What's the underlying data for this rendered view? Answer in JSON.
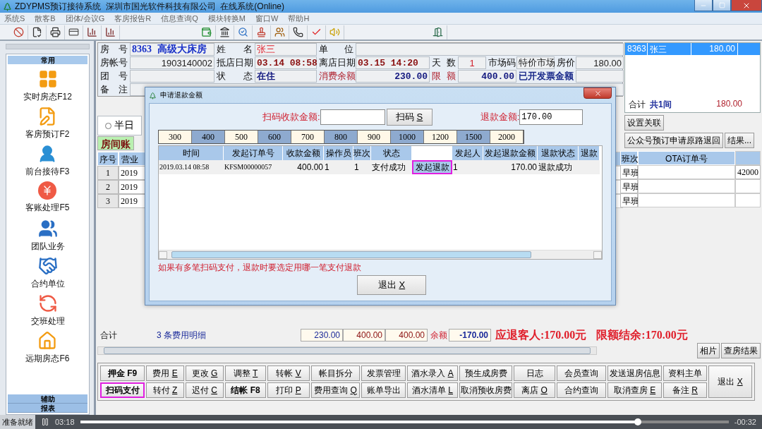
{
  "window": {
    "title": "ZDYPMS预订接待系统  深圳市国光软件科技有限公司  在线系统(Online)"
  },
  "menu": [
    "系统S",
    "散客B",
    "团体/会议G",
    "客房报告R",
    "信息查询Q",
    "模块转换M",
    "窗口W",
    "帮助H"
  ],
  "sidebar": {
    "sections": [
      {
        "label": "常用",
        "expanded": true,
        "items": [
          {
            "label": "实时房态F12",
            "kind": "grid"
          },
          {
            "label": "客房预订F2",
            "kind": "note"
          },
          {
            "label": "前台接待F3",
            "kind": "reception"
          },
          {
            "label": "客账处理F5",
            "kind": "bill"
          },
          {
            "label": "团队业务",
            "kind": "group"
          },
          {
            "label": "合约单位",
            "kind": "contract"
          },
          {
            "label": "交班处理",
            "kind": "shift"
          },
          {
            "label": "远期房态F6",
            "kind": "forecast"
          }
        ]
      },
      {
        "label": "辅助",
        "expanded": false
      },
      {
        "label": "报表",
        "expanded": false
      }
    ]
  },
  "info": {
    "rows": [
      [
        {
          "label": "房号",
          "value": "8363",
          "extra": "高级大床房",
          "kind": "room",
          "alert": false,
          "emphasis": false
        },
        {
          "label": "姓名",
          "value": "张三",
          "kind": "name",
          "alert": false,
          "emphasis": false
        },
        {
          "label": "单位",
          "kind": "plain",
          "alert": false,
          "emphasis": false
        }
      ],
      [
        {
          "label": "房帐号",
          "value": "1903140002",
          "kind": "plain",
          "alert": false,
          "emphasis": false
        },
        {
          "label": "抵店日期",
          "value": "03.14 08:58",
          "kind": "date",
          "alert": false,
          "emphasis": false
        },
        {
          "label": "离店日期",
          "value": "03.15 14:20",
          "kind": "date",
          "alert": false,
          "emphasis": false
        },
        {
          "label": "天数",
          "value": "1",
          "kind": "count",
          "alert": false,
          "emphasis": false
        },
        {
          "label": "市场码",
          "value": "特价市场",
          "kind": "plain",
          "alert": false,
          "emphasis": false
        },
        {
          "label": "房价",
          "value": "180.00",
          "kind": "plain",
          "alert": false,
          "emphasis": false
        }
      ],
      [
        {
          "label": "团号",
          "kind": "plain",
          "alert": false,
          "emphasis": false
        },
        {
          "label": "状态",
          "value": "在住",
          "kind": "status",
          "alert": false,
          "emphasis": false
        },
        {
          "label": "消费余额",
          "value": "230.00",
          "kind": "money",
          "alert": true,
          "emphasis": false
        },
        {
          "label": "限额",
          "value": "400.00",
          "kind": "money",
          "alert": true,
          "emphasis": false
        },
        {
          "label": "已开发票金额",
          "kind": "plain",
          "alert": false,
          "emphasis": true
        }
      ],
      [
        {
          "label": "备注",
          "kind": "plain",
          "alert": false,
          "emphasis": false
        }
      ]
    ]
  },
  "room_list": {
    "rows": [
      {
        "room": "8363",
        "name": "张三",
        "price": "180.00",
        "selected": true
      }
    ],
    "total": {
      "label": "合计",
      "count": "共1间",
      "amount": "180.00"
    }
  },
  "side_buttons": [
    "设置关联",
    "公众号预订申请原路退回",
    "结果..."
  ],
  "options": [
    {
      "label": "半日",
      "checked": false
    }
  ],
  "ledger": {
    "tabs": [
      {
        "label": "房间账",
        "selected": true
      }
    ],
    "columns": [
      "序号",
      "营业"
    ],
    "rows": [
      {
        "cells": [
          "1",
          "2019"
        ]
      },
      {
        "cells": [
          "2",
          "2019"
        ]
      },
      {
        "cells": [
          "3",
          "2019"
        ]
      }
    ],
    "right_columns": [
      "班次",
      "OTA订单号"
    ],
    "right_rows": [
      {
        "shift": "早班",
        "column_3": "42000"
      },
      {
        "shift": "早班"
      },
      {
        "shift": "早班"
      }
    ]
  },
  "summary": {
    "label": "合计",
    "detail": "3 条费用明细",
    "amounts": [
      "230.00",
      "400.00",
      "400.00"
    ],
    "balance_label": "余额",
    "balance": "-170.00",
    "refund": "应退客人:170.00元",
    "limit": "限额结余:170.00元"
  },
  "photo_buttons": [
    "相片",
    "查房结果"
  ],
  "actions": [
    [
      {
        "label": "押金 F9",
        "bold": true,
        "highlighted": false
      },
      {
        "label": "扫码支付",
        "bold": true,
        "highlighted": true
      }
    ],
    [
      {
        "label": "费用",
        "key": "E"
      },
      {
        "label": "转付",
        "key": "Z"
      }
    ],
    [
      {
        "label": "更改",
        "key": "G"
      },
      {
        "label": "迟付",
        "key": "C"
      }
    ],
    [
      {
        "label": "调整",
        "key": "T"
      },
      {
        "label": "结帐 F8",
        "bold": true
      }
    ],
    [
      {
        "label": "转帐",
        "key": "V"
      },
      {
        "label": "打印",
        "key": "P"
      }
    ],
    [
      {
        "label": "帐目拆分"
      },
      {
        "label": "费用查询",
        "key": "Q"
      }
    ],
    [
      {
        "label": "发票管理"
      },
      {
        "label": "账单导出"
      }
    ],
    [
      {
        "label": "酒水录入",
        "key": "A"
      },
      {
        "label": "酒水清单",
        "key": "L"
      }
    ],
    [
      {
        "label": "预生成房费"
      },
      {
        "label": "取消预收房费"
      }
    ],
    [
      {
        "label": "日志"
      },
      {
        "label": "离店",
        "key": "O"
      }
    ],
    [
      {
        "label": "会员查询"
      },
      {
        "label": "合约查询"
      }
    ],
    [
      {
        "label": "发送退房信息"
      },
      {
        "label": "取消查房",
        "key": "E"
      }
    ],
    [
      {
        "label": "资料主单"
      },
      {
        "label": "备注",
        "key": "R"
      }
    ],
    [
      {
        "label": "退出",
        "key": "X"
      }
    ]
  ],
  "dialog": {
    "title": "申请退款金额",
    "scan_label": "扫码收款金额:",
    "scan_button": {
      "label": "扫码",
      "key": "S"
    },
    "refund_label": "退款金额:",
    "refund_value": "170.00",
    "amounts": [
      "300",
      "400",
      "500",
      "600",
      "700",
      "800",
      "900",
      "1000",
      "1200",
      "1500",
      "2000"
    ],
    "columns": [
      {
        "label": "时间",
        "kind": "text"
      },
      {
        "label": "发起订单号",
        "kind": "text"
      },
      {
        "label": "收款金额",
        "kind": "text"
      },
      {
        "label": "操作员",
        "kind": "text"
      },
      {
        "label": "班次",
        "kind": "text"
      },
      {
        "label": "状态",
        "kind": "text"
      },
      {
        "kind": "action"
      },
      {
        "label": "发起人",
        "kind": "text"
      },
      {
        "label": "发起退款金额",
        "kind": "text"
      },
      {
        "label": "退款状态",
        "kind": "text"
      },
      {
        "label": "退款",
        "kind": "text"
      }
    ],
    "rows": [
      {
        "cells": [
          "2019.03.14 08:58",
          "KFSM00000057",
          "400.00",
          "1",
          "1",
          "支付成功",
          "",
          "1",
          "170.00",
          "退款成功",
          ""
        ],
        "action": {
          "label": "发起退款",
          "highlighted": true
        }
      }
    ],
    "note": "如果有多笔扫码支付，退款时要选定用哪一笔支付退款",
    "exit_button": {
      "label": "退出",
      "key": "X"
    }
  },
  "status_bar": {
    "text": "准备就绪"
  },
  "player": {
    "elapsed": "03:18",
    "remaining": "-00:32",
    "level": 0.86
  }
}
